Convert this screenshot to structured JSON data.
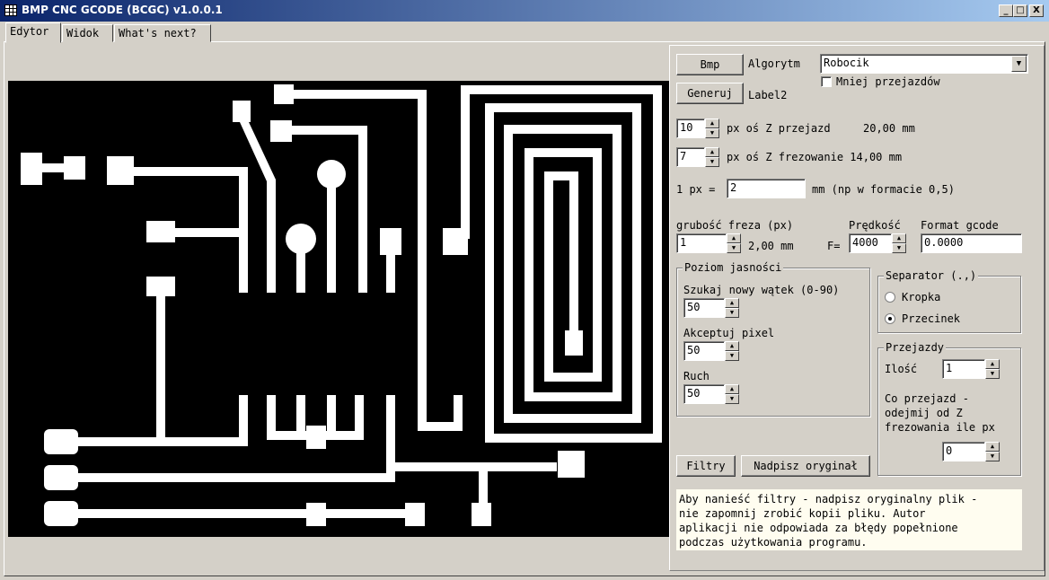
{
  "window": {
    "title": "BMP CNC GCODE (BCGC) v1.0.0.1",
    "controls": [
      "_",
      "□",
      "X"
    ]
  },
  "tabs": [
    {
      "label": "Edytor",
      "active": true
    },
    {
      "label": "Widok",
      "active": false
    },
    {
      "label": "What's next?",
      "active": false
    }
  ],
  "controls": {
    "bmp_button": "Bmp",
    "algorithm_label": "Algorytm",
    "algorithm_value": "Robocik",
    "fewer_passes_label": "Mniej przejazdów",
    "fewer_passes_checked": false,
    "generate_button": "Generuj",
    "label2": "Label2",
    "z_travel_value": "10",
    "z_travel_label": "px oś Z przejazd",
    "z_travel_mm": "20,00 mm",
    "z_mill_value": "7",
    "z_mill_label": "px oś Z frezowanie 14,00 mm",
    "px_label": "1 px =",
    "px_value": "2",
    "px_hint": "mm (np w formacie 0,5)",
    "cutter_label": "grubość freza (px)",
    "cutter_value": "1",
    "cutter_mm": "2,00 mm",
    "speed_label": "Prędkość",
    "speed_prefix": "F=",
    "speed_value": "4000",
    "format_label": "Format gcode",
    "format_value": "0.0000"
  },
  "brightness": {
    "title": "Poziom jasności",
    "search_label": "Szukaj nowy wątek (0-90)",
    "search_value": "50",
    "accept_label": "Akceptuj pixel",
    "accept_value": "50",
    "move_label": "Ruch",
    "move_value": "50"
  },
  "separator": {
    "title": "Separator (.,)",
    "options": [
      {
        "label": "Kropka",
        "selected": false
      },
      {
        "label": "Przecinek",
        "selected": true
      }
    ]
  },
  "passes": {
    "title": "Przejazdy",
    "count_label": "Ilość",
    "count_value": "1",
    "subtract_label": "Co przejazd -\nodejmij od Z\nfrezowania ile px",
    "subtract_value": "0"
  },
  "filters_button": "Filtry",
  "overwrite_button": "Nadpisz oryginał",
  "note": "Aby nanieść filtry - nadpisz oryginalny plik -\nnie zapomnij zrobić kopii pliku. Autor\naplikacji nie odpowiada za błędy popełnione\npodczas użytkowania programu.",
  "colors": {
    "canvas_bg": "#000000",
    "trace": "#ffffff",
    "title_start": "#0a246a",
    "title_end": "#a6caf0"
  }
}
